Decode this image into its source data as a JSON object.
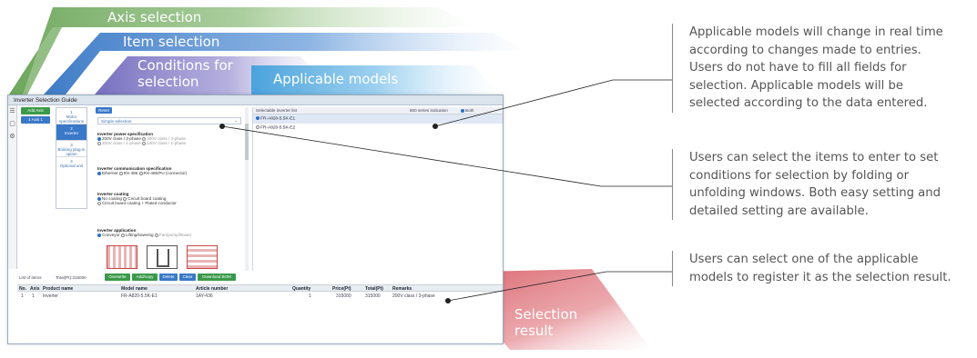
{
  "callouts": {
    "axis_selection": "Axis selection",
    "item_selection": "Item selection",
    "conditions_for_selection": [
      "Conditions for",
      "selection"
    ],
    "applicable_models": "Applicable models",
    "selection_result": [
      "Selection",
      "result"
    ]
  },
  "app": {
    "window_title": "Inverter Selection Guide",
    "add_axis_label": "Add Axis",
    "axis_item": "1 Axis 1",
    "reset_label": "Reset",
    "nav_items": [
      {
        "num": "1",
        "label": "Motor specifications"
      },
      {
        "num": "2",
        "label": "Inverter"
      },
      {
        "num": "3",
        "label": "Braking plug-in option"
      },
      {
        "num": "4",
        "label": "Optional unit"
      }
    ],
    "mode_select": "Simple selection",
    "conditions": {
      "power_title": "Inverter power specification",
      "power_opts": [
        "200V class / 3-phase",
        "400V class / 3-phase",
        "200V class / 1-phase",
        "100V class / 1-phase"
      ],
      "comm_title": "Inverter communication specification",
      "comm_opts": [
        "Ethernet",
        "RS-485",
        "RS-485/PU (connector)"
      ],
      "coating_title": "Inverter coating",
      "coating_opts": [
        "No coating",
        "Circuit board coating",
        "Circuit board coating + Plated conductor"
      ],
      "application_title": "Inverter application",
      "application_opts": [
        "Conveyor",
        "Lifting/lowering",
        "Fan/pump/blower"
      ]
    },
    "inverter_list_title": "Selectable inverter list",
    "series_indication": "800 series indication",
    "series_option": "Both",
    "models": [
      "FR-A820-5.5K-E1",
      "FR-A820-5.5K-E2"
    ],
    "list_count": "List of items",
    "total_price": "Total(Pt):315000",
    "action_buttons": [
      "Overwrite",
      "Add/copy",
      "Delete",
      "Clear",
      "Download BOM"
    ],
    "table": {
      "headers": [
        "No.",
        "Axis",
        "Product name",
        "Model name",
        "Article number",
        "Quantity",
        "Price(Pt)",
        "Total(Pt)",
        "Remarks"
      ],
      "row": [
        "1",
        "1",
        "Inverter",
        "FR-A820-5.5K-E1",
        "1AY-436",
        "1",
        "315000",
        "315000",
        "200V class / 3-phase"
      ]
    }
  },
  "explanations": [
    [
      "Applicable models will change in real time",
      "according to changes made to entries.",
      "Users do not have to fill all fields for",
      "selection. Applicable models will be",
      "selected according to the data entered."
    ],
    [
      "Users can select the items to enter to set",
      "conditions for selection by folding or",
      "unfolding windows. Both easy setting and",
      "detailed setting are available."
    ],
    [
      "Users can select one of the applicable",
      "models to register it as the selection result."
    ]
  ],
  "colors": {
    "axis_band": "#86b578",
    "item_band": "#5b8fd1",
    "conditions_band": "#8c86c9",
    "applicable_band": "#6fb6e3",
    "result_band": "#d97479",
    "accent_blue": "#3a78c8",
    "accent_green": "#3a9a4a"
  }
}
